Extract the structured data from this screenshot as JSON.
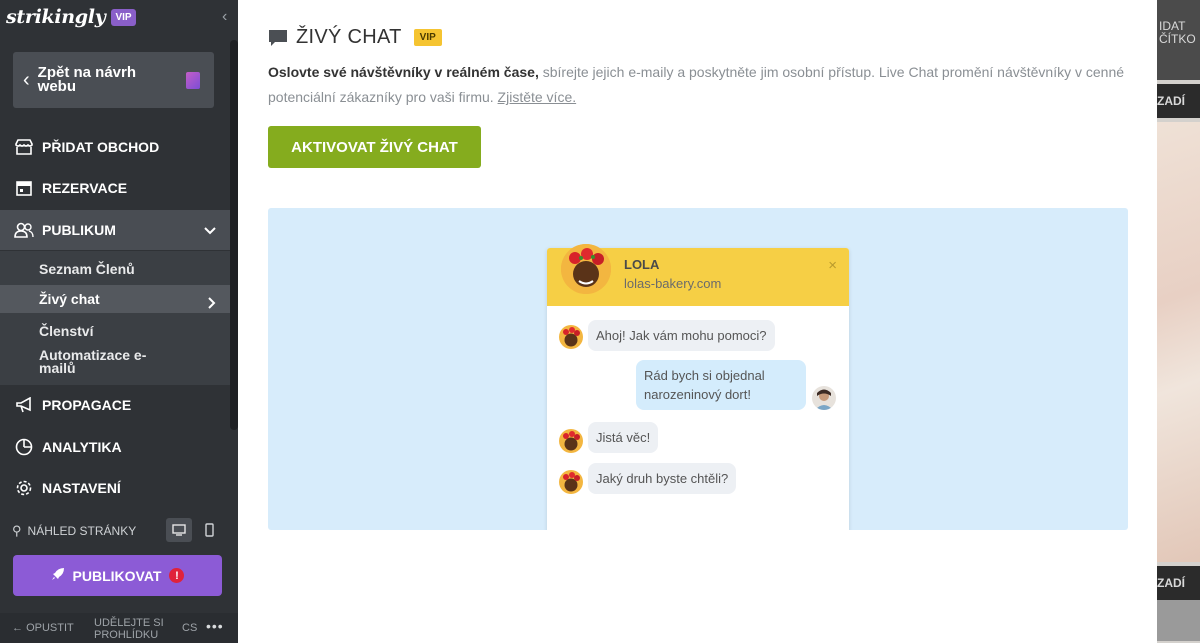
{
  "sidebar": {
    "logo": "strikingly",
    "vip": "VIP",
    "back_label": "Zpět na návrh webu",
    "nav": [
      {
        "label": "PŘIDAT OBCHOD",
        "icon": "store-icon"
      },
      {
        "label": "REZERVACE",
        "icon": "calendar-icon"
      },
      {
        "label": "PUBLIKUM",
        "icon": "audience-icon"
      },
      {
        "label": "PROPAGACE",
        "icon": "megaphone-icon"
      },
      {
        "label": "ANALYTIKA",
        "icon": "pie-chart-icon"
      },
      {
        "label": "NASTAVENÍ",
        "icon": "gear-icon"
      }
    ],
    "sub_items": [
      "Seznam Členů",
      "Živý chat",
      "Členství",
      "Automatizace e-mailů"
    ],
    "preview_label": "NÁHLED STRÁNKY",
    "publish_label": "PUBLIKOVAT",
    "publish_alert": "!",
    "footer": {
      "exit": "OPUSTIT",
      "feedback": "UDĚLEJTE SI PROHLÍDKU",
      "lang": "CS",
      "more": "•••"
    }
  },
  "main": {
    "title": "ŽIVÝ CHAT",
    "vip": "VIP",
    "desc_strong": "Oslovte své návštěvníky v reálném čase,",
    "desc_rest": " sbírejte jejich e-maily a poskytněte jim osobní přístup. Live Chat promění návštěvníky v cenné potenciální zákazníky pro vaši firmu. ",
    "learn_more": "Zjistěte více.",
    "activate_label": "AKTIVOVAT ŽIVÝ CHAT"
  },
  "chat": {
    "name": "LOLA",
    "site": "lolas-bakery.com",
    "close": "×",
    "messages": [
      {
        "from": "bot",
        "text": "Ahoj! Jak vám mohu pomoci?"
      },
      {
        "from": "user",
        "text": "Rád bych si objednal narozeninový dort!"
      },
      {
        "from": "bot",
        "text": "Jistá věc!"
      },
      {
        "from": "bot",
        "text": "Jaký druh byste chtěli?"
      }
    ]
  },
  "backdrop": {
    "top_text": "IDAT ČÍTKO",
    "bar_text": "ZADÍ"
  },
  "colors": {
    "sidebar_bg": "#2f3236",
    "publish": "#8c5bd6",
    "activate": "#85ac1e",
    "vip_yellow": "#f5c431",
    "preview_bg": "#d7ecfb",
    "chat_header": "#f6cf45"
  }
}
